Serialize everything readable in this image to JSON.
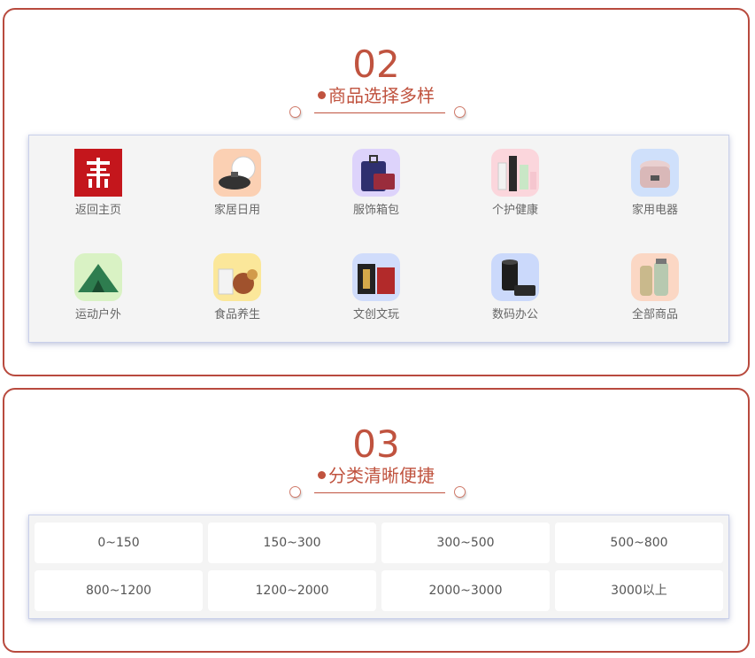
{
  "section2": {
    "number": "02",
    "subtitle": "商品选择多样",
    "categories": [
      {
        "label": "返回主页",
        "icon": "home-logo-icon",
        "color": "#c4161c"
      },
      {
        "label": "家居日用",
        "icon": "cookware-icon",
        "color": "#f6a06a"
      },
      {
        "label": "服饰箱包",
        "icon": "luggage-icon",
        "color": "#b8a6f0"
      },
      {
        "label": "个护健康",
        "icon": "cosmetics-icon",
        "color": "#f7a7b5"
      },
      {
        "label": "家用电器",
        "icon": "rice-cooker-icon",
        "color": "#9ec2f5"
      },
      {
        "label": "运动户外",
        "icon": "tent-icon",
        "color": "#a8e07a"
      },
      {
        "label": "食品养生",
        "icon": "food-icon",
        "color": "#f8d04a"
      },
      {
        "label": "文创文玩",
        "icon": "gift-box-icon",
        "color": "#9ab6f2"
      },
      {
        "label": "数码办公",
        "icon": "camera-lens-icon",
        "color": "#8fb2f7"
      },
      {
        "label": "全部商品",
        "icon": "thermos-icon",
        "color": "#f4b291"
      }
    ]
  },
  "section3": {
    "number": "03",
    "subtitle": "分类清晰便捷",
    "price_ranges": [
      "0~150",
      "150~300",
      "300~500",
      "500~800",
      "800~1200",
      "1200~2000",
      "2000~3000",
      "3000以上"
    ]
  },
  "colors": {
    "accent": "#c0533f",
    "border": "#b84a3e"
  }
}
